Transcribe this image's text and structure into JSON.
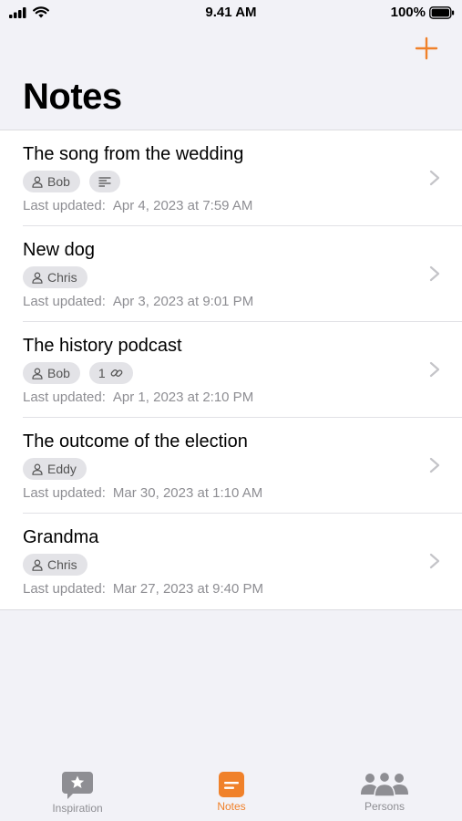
{
  "status_bar": {
    "time": "9.41 AM",
    "battery": "100%"
  },
  "header": {
    "title": "Notes"
  },
  "notes": [
    {
      "title": "The song from the wedding",
      "tags": [
        {
          "type": "person",
          "label": "Bob"
        },
        {
          "type": "text"
        }
      ],
      "meta_label": "Last updated:",
      "updated": "Apr 4, 2023 at 7:59 AM"
    },
    {
      "title": "New dog",
      "tags": [
        {
          "type": "person",
          "label": "Chris"
        }
      ],
      "meta_label": "Last updated:",
      "updated": "Apr 3, 2023 at 9:01 PM"
    },
    {
      "title": "The history podcast",
      "tags": [
        {
          "type": "person",
          "label": "Bob"
        },
        {
          "type": "link",
          "label": "1"
        }
      ],
      "meta_label": "Last updated:",
      "updated": "Apr 1, 2023 at 2:10 PM"
    },
    {
      "title": "The outcome of the election",
      "tags": [
        {
          "type": "person",
          "label": "Eddy"
        }
      ],
      "meta_label": "Last updated:",
      "updated": "Mar 30, 2023 at 1:10 AM"
    },
    {
      "title": "Grandma",
      "tags": [
        {
          "type": "person",
          "label": "Chris"
        }
      ],
      "meta_label": "Last updated:",
      "updated": "Mar 27, 2023 at 9:40 PM"
    }
  ],
  "tabs": [
    {
      "label": "Inspiration",
      "icon": "star-bubble-icon",
      "active": false
    },
    {
      "label": "Notes",
      "icon": "note-icon",
      "active": true
    },
    {
      "label": "Persons",
      "icon": "persons-icon",
      "active": false
    }
  ],
  "colors": {
    "accent": "#f0812a",
    "inactive": "#8e8e93"
  }
}
